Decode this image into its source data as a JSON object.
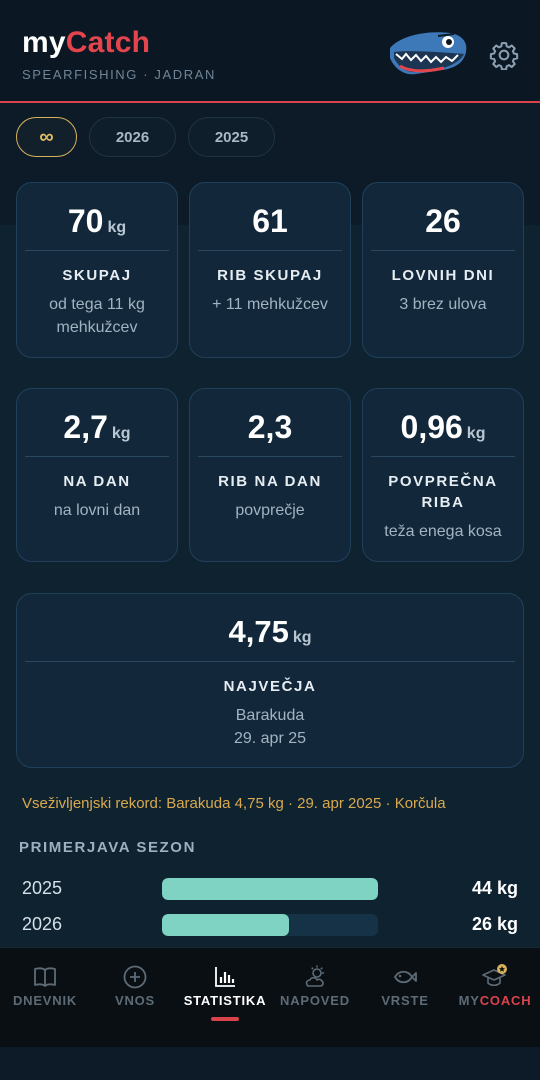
{
  "app": {
    "title_my": "my",
    "title_catch": "Catch",
    "subtitle": "SPEARFISHING · JADRAN"
  },
  "tabs": [
    {
      "label": "∞",
      "active": true
    },
    {
      "label": "2026",
      "active": false
    },
    {
      "label": "2025",
      "active": false
    }
  ],
  "cards": {
    "total": {
      "value": "70",
      "unit": "kg",
      "label": "SKUPAJ",
      "sub1": "od tega 11 kg",
      "sub2": "mehkužcev"
    },
    "fish_total": {
      "value": "61",
      "label": "RIB SKUPAJ",
      "sub": "+ 11 mehkužcev"
    },
    "hunt_days": {
      "value": "26",
      "label": "LOVNIH DNI",
      "sub": "3 brez ulova"
    },
    "per_day": {
      "value": "2,7",
      "unit": "kg",
      "label": "NA DAN",
      "sub": "na lovni dan"
    },
    "fish_per_day": {
      "value": "2,3",
      "label": "RIB NA DAN",
      "sub": "povprečje"
    },
    "avg_fish": {
      "value": "0,96",
      "unit": "kg",
      "label1": "POVPREČNA",
      "label2": "RIBA",
      "sub": "teža enega kosa"
    },
    "biggest": {
      "value": "4,75",
      "unit": "kg",
      "label": "NAJVEČJA",
      "sub1": "Barakuda",
      "sub2": "29. apr 25"
    }
  },
  "record_text": "Vseživljenjski rekord: Barakuda 4,75 kg · 29. apr 2025 · Korčula",
  "comparison": {
    "title": "PRIMERJAVA SEZON",
    "rows": [
      {
        "year": "2025",
        "value_label": "44 kg",
        "fraction": 1.0
      },
      {
        "year": "2026",
        "value_label": "26 kg",
        "fraction": 0.59
      }
    ]
  },
  "nav": [
    {
      "label": "DNEVNIK",
      "icon": "book-icon",
      "active": false
    },
    {
      "label": "VNOS",
      "icon": "plus-circle-icon",
      "active": false
    },
    {
      "label": "STATISTIKA",
      "icon": "bar-chart-icon",
      "active": true
    },
    {
      "label": "NAPOVED",
      "icon": "weather-icon",
      "active": false
    },
    {
      "label": "VRSTE",
      "icon": "fish-icon",
      "active": false
    },
    {
      "label_my": "MY",
      "label_coach": "COACH",
      "icon": "graduation-cap-icon",
      "active": false
    }
  ],
  "colors": {
    "accent_red": "#d9434b",
    "gold": "#d8b25a",
    "teal_bar": "#7fd3c3",
    "background": "#0c1b27"
  }
}
